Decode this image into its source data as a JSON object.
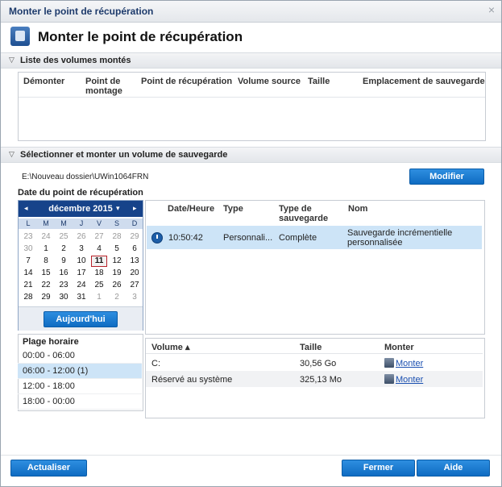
{
  "window": {
    "title": "Monter le point de récupération",
    "close": "×"
  },
  "header": {
    "title": "Monter le point de récupération"
  },
  "sections": {
    "mounted": "Liste des volumes montés",
    "select": "Sélectionner et monter un volume de sauvegarde"
  },
  "mounted_table": {
    "columns": [
      "Démonter",
      "Point de montage",
      "Point de récupération",
      "Volume source",
      "Taille",
      "Emplacement de sauvegarde"
    ]
  },
  "backup_path": "E:\\Nouveau dossier\\UWin1064FRN",
  "modify_button": "Modifier",
  "date_label": "Date du point de récupération",
  "calendar": {
    "month": "décembre 2015",
    "prev": "◂",
    "next": "▸",
    "menu": "▾",
    "weekdays": [
      "L",
      "M",
      "M",
      "J",
      "V",
      "S",
      "D"
    ],
    "weeks": [
      [
        "23",
        "24",
        "25",
        "26",
        "27",
        "28",
        "29"
      ],
      [
        "30",
        "1",
        "2",
        "3",
        "4",
        "5",
        "6"
      ],
      [
        "7",
        "8",
        "9",
        "10",
        "11",
        "12",
        "13"
      ],
      [
        "14",
        "15",
        "16",
        "17",
        "18",
        "19",
        "20"
      ],
      [
        "21",
        "22",
        "23",
        "24",
        "25",
        "26",
        "27"
      ],
      [
        "28",
        "29",
        "30",
        "31",
        "1",
        "2",
        "3"
      ]
    ],
    "today_button": "Aujourd'hui"
  },
  "time_range": {
    "label": "Plage horaire",
    "slots": [
      "00:00 - 06:00",
      "06:00 - 12:00   (1)",
      "12:00 - 18:00",
      "18:00 - 00:00"
    ]
  },
  "points_table": {
    "columns": [
      "Date/Heure",
      "Type",
      "Type de sauvegarde",
      "Nom"
    ],
    "rows": [
      {
        "time": "10:50:42",
        "type": "Personnali...",
        "backup_type": "Complète",
        "name": "Sauvegarde incrémentielle personnalisée"
      }
    ]
  },
  "volume_table": {
    "columns": [
      "Volume ▴",
      "Taille",
      "Monter"
    ],
    "rows": [
      {
        "volume": "C:",
        "size": "30,56 Go",
        "action": "Monter"
      },
      {
        "volume": "Réservé au système",
        "size": "325,13 Mo",
        "action": "Monter"
      }
    ]
  },
  "footer": {
    "refresh": "Actualiser",
    "close": "Fermer",
    "help": "Aide"
  },
  "colors": {
    "accent": "#0f6cc2",
    "calendar_header": "#16438a",
    "selection": "#cde4f7"
  }
}
